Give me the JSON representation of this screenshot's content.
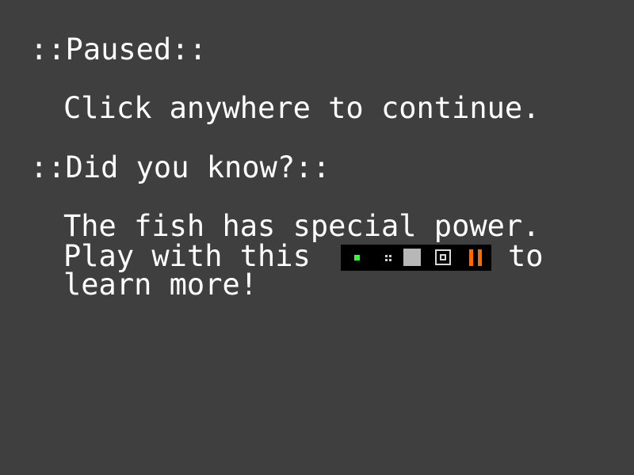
{
  "pause_screen": {
    "heading": "::Paused::",
    "hint": "Click anywhere to continue."
  },
  "tip": {
    "heading": "::Did you know?::",
    "line1": "The fish has special power.",
    "line2_before": "Play with this",
    "line2_after": "to",
    "line3": "learn more!"
  },
  "toolbar": {
    "background": "#000000",
    "buttons": [
      {
        "icon": "green-dot-icon",
        "color": "#33ff33"
      },
      {
        "icon": "small-grid-icon",
        "color": "#cfcfcf"
      },
      {
        "icon": "filled-square-icon",
        "color": "#b7b7b7"
      },
      {
        "icon": "framed-square-icon",
        "color": "#d8d8d8"
      },
      {
        "icon": "pause-icon",
        "color": "#ff6a00"
      }
    ]
  },
  "colors": {
    "background": "#3f3f3f",
    "text": "#ffffff"
  }
}
